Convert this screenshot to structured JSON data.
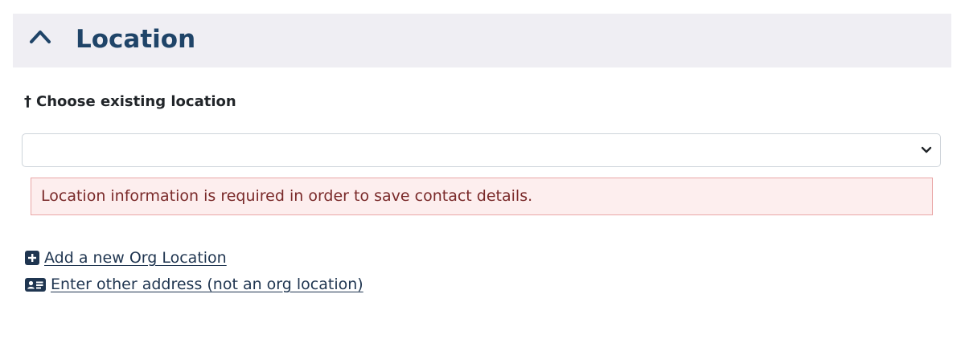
{
  "section": {
    "title": "Location",
    "collapse_icon": "chevron-up-icon"
  },
  "field": {
    "required_marker": "†",
    "label": "Choose existing location",
    "selected_value": "",
    "caret_icon": "chevron-down-icon"
  },
  "alert": {
    "message": "Location information is required in order to save contact details."
  },
  "links": [
    {
      "icon": "plus-square-icon",
      "label": " Add a new Org Location"
    },
    {
      "icon": "address-card-icon",
      "label": " Enter other address (not an org location)"
    }
  ],
  "colors": {
    "header_bg": "#efeef3",
    "title": "#1f4468",
    "alert_bg": "#fdeeee",
    "alert_border": "#e9a6a6",
    "alert_text": "#7a2a2a",
    "link": "#1f3550"
  }
}
